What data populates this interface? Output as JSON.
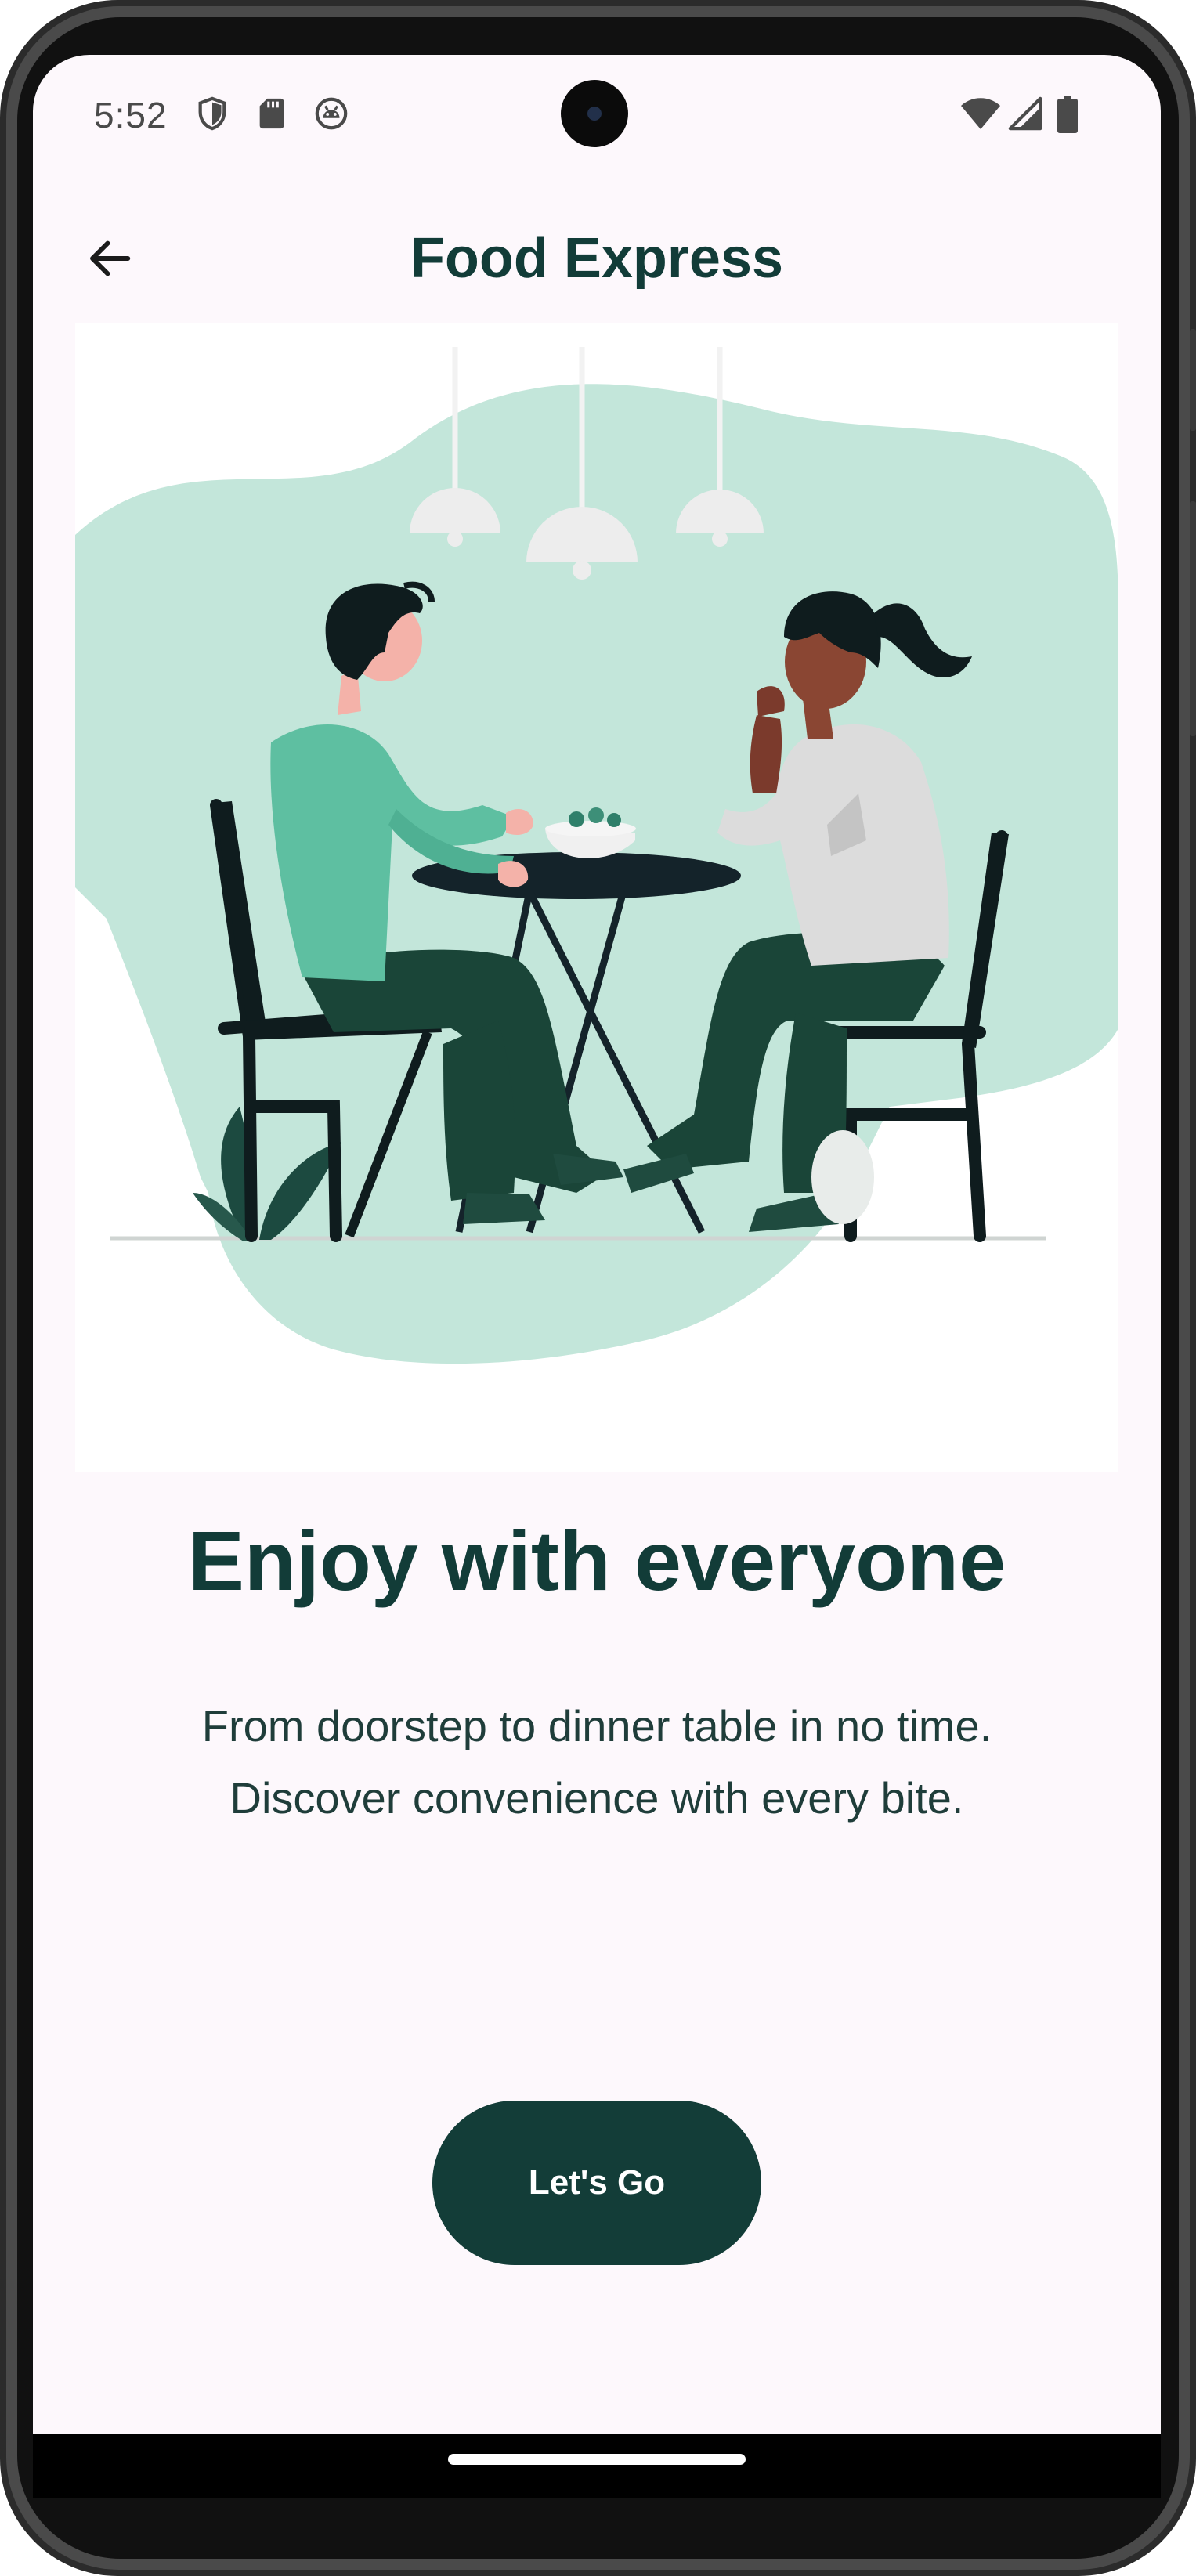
{
  "status_bar": {
    "time": "5:52",
    "left_icons": [
      "shield-icon",
      "sd-card-icon",
      "android-debug-icon"
    ],
    "right_icons": [
      "wifi-icon",
      "cellular-signal-icon",
      "battery-icon"
    ]
  },
  "app_bar": {
    "back_icon": "arrow-back-icon",
    "title": "Food Express"
  },
  "hero": {
    "illustration": "two-people-dining-illustration"
  },
  "content": {
    "headline": "Enjoy with everyone",
    "subtitle": "From doorstep to dinner table in no time. Discover convenience with every bite."
  },
  "cta": {
    "label": "Let's Go"
  },
  "colors": {
    "primary": "#133d38",
    "background": "#fdf8fc",
    "illustration_blob": "#c3e6da",
    "illustration_accent": "#5ebfa1"
  }
}
